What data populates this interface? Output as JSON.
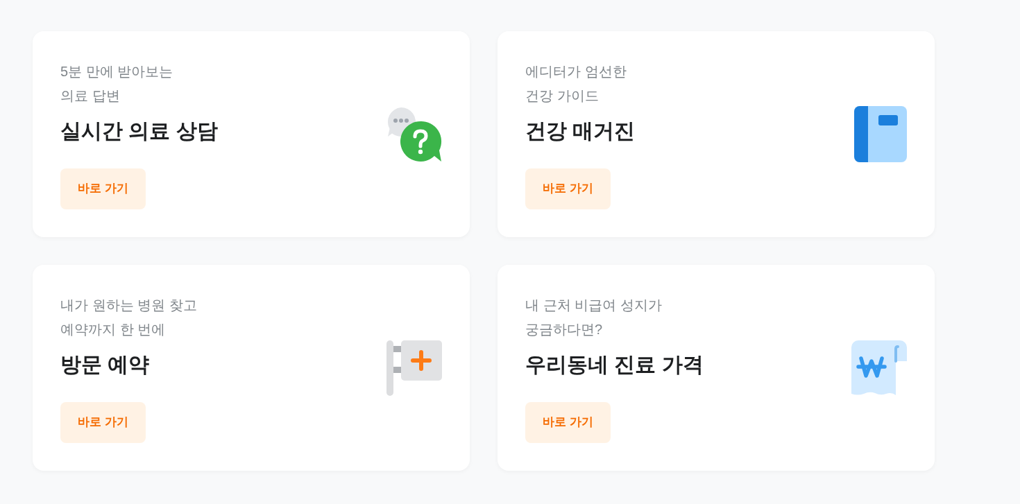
{
  "cards": [
    {
      "subtitle_lines": [
        "5분 만에 받아보는",
        "의료 답변"
      ],
      "title": "실시간 의료 상담",
      "button": "바로 가기"
    },
    {
      "subtitle_lines": [
        "에디터가 엄선한",
        "건강 가이드"
      ],
      "title": "건강 매거진",
      "button": "바로 가기"
    },
    {
      "subtitle_lines": [
        "내가 원하는 병원 찾고",
        "예약까지 한 번에"
      ],
      "title": "방문 예약",
      "button": "바로 가기"
    },
    {
      "subtitle_lines": [
        "내 근처 비급여 성지가",
        "궁금하다면?"
      ],
      "title": "우리동네 진료 가격",
      "button": "바로 가기"
    }
  ]
}
